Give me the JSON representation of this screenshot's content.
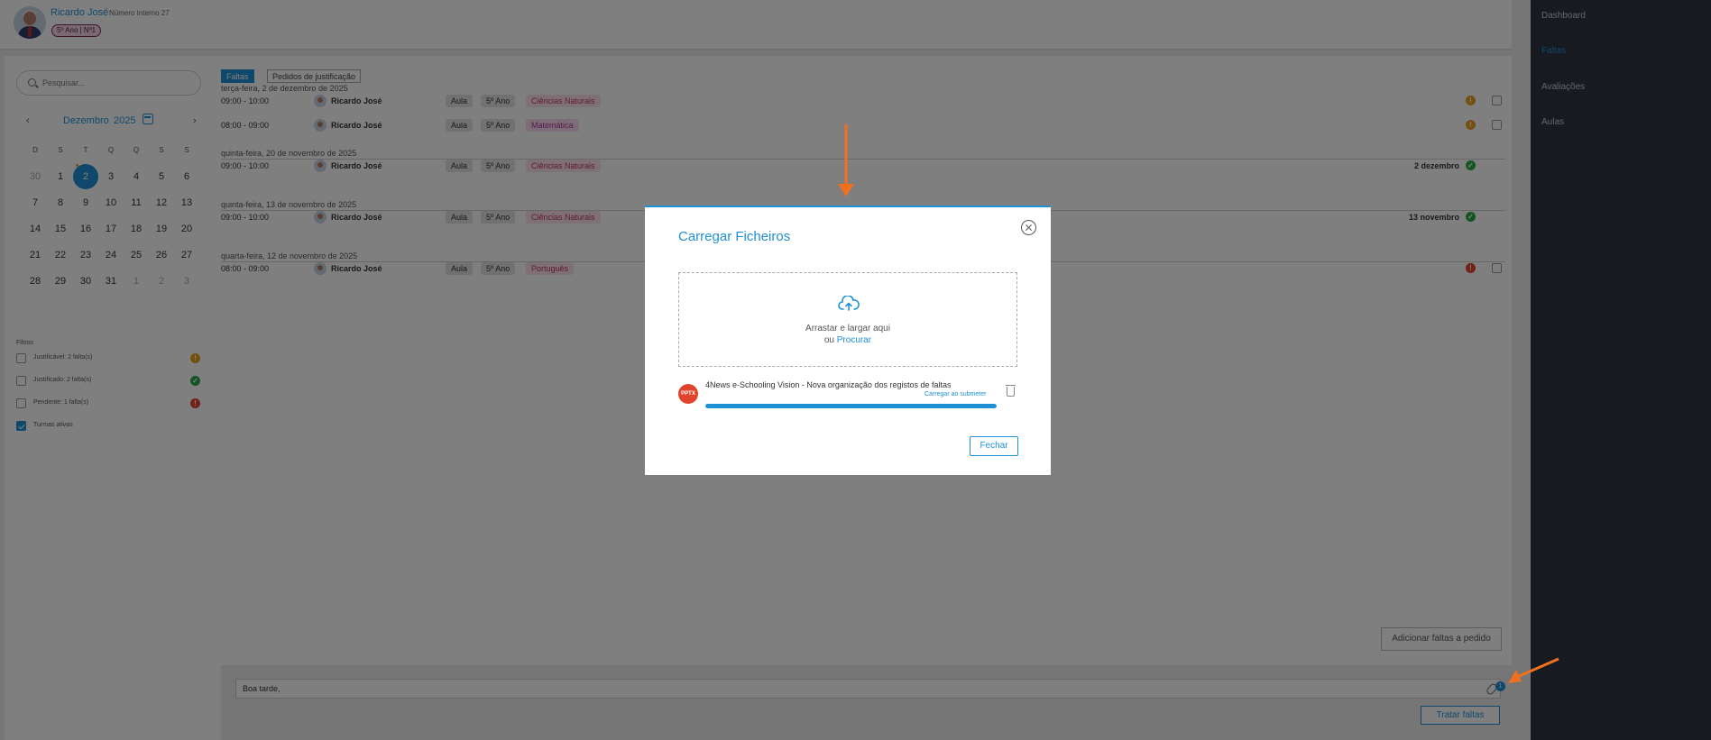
{
  "header": {
    "student_name": "Ricardo José",
    "internal_number": "Número Interno 27",
    "class_badge": "5º Ano | Nº1"
  },
  "sidebar": {
    "items": [
      {
        "label": "Dashboard",
        "active": false
      },
      {
        "label": "Faltas",
        "active": true
      },
      {
        "label": "Avaliações",
        "active": false
      },
      {
        "label": "Aulas",
        "active": false
      }
    ]
  },
  "search": {
    "placeholder": "Pesquisar..."
  },
  "calendar": {
    "month": "Dezembro",
    "year": "2025",
    "prev": "‹",
    "next": "›",
    "weekdays": [
      "D",
      "S",
      "T",
      "Q",
      "Q",
      "S",
      "S"
    ],
    "weeks": [
      [
        "30",
        "1",
        "2",
        "3",
        "4",
        "5",
        "6"
      ],
      [
        "7",
        "8",
        "9",
        "10",
        "11",
        "12",
        "13"
      ],
      [
        "14",
        "15",
        "16",
        "17",
        "18",
        "19",
        "20"
      ],
      [
        "21",
        "22",
        "23",
        "24",
        "25",
        "26",
        "27"
      ],
      [
        "28",
        "29",
        "30",
        "31",
        "1",
        "2",
        "3"
      ]
    ],
    "selected_day": "2"
  },
  "filters": {
    "title": "Filtros",
    "items": [
      {
        "label": "Justificável: 2 falta(s)",
        "checked": false,
        "status": "!"
      },
      {
        "label": "Justificado: 2 falta(s)",
        "checked": false,
        "status": "✓"
      },
      {
        "label": "Pendente: 1 falta(s)",
        "checked": false,
        "status": "!"
      },
      {
        "label": "Turmas ativas",
        "checked": true,
        "status": ""
      }
    ]
  },
  "tabs": [
    {
      "label": "Faltas",
      "active": true
    },
    {
      "label": "Pedidos de justificação",
      "active": false
    }
  ],
  "groups": [
    {
      "date": "terça-feira, 2 de dezembro de 2025",
      "rows": [
        {
          "time": "09:00 - 10:00",
          "student": "Ricardo José",
          "type": "Aula",
          "year": "5º Ano",
          "subject": "Ciências Naturais",
          "status": "!",
          "justified_date": "",
          "checkbox": true
        },
        {
          "time": "08:00 - 09:00",
          "student": "Ricardo José",
          "type": "Aula",
          "year": "5º Ano",
          "subject": "Matemática",
          "status": "!",
          "justified_date": "",
          "checkbox": true
        }
      ]
    },
    {
      "date": "quinta-feira, 20 de novembro de 2025",
      "rows": [
        {
          "time": "09:00 - 10:00",
          "student": "Ricardo José",
          "type": "Aula",
          "year": "5º Ano",
          "subject": "Ciências Naturais",
          "status": "✓",
          "justified_date": "2 dezembro",
          "checkbox": false
        }
      ]
    },
    {
      "date": "quinta-feira, 13 de novembro de 2025",
      "rows": [
        {
          "time": "09:00 - 10:00",
          "student": "Ricardo José",
          "type": "Aula",
          "year": "5º Ano",
          "subject": "Ciências Naturais",
          "status": "✓",
          "justified_date": "13 novembro",
          "checkbox": false
        }
      ]
    },
    {
      "date": "quarta-feira, 12 de novembro de 2025",
      "rows": [
        {
          "time": "08:00 - 09:00",
          "student": "Ricardo José",
          "type": "Aula",
          "year": "5º Ano",
          "subject": "Português",
          "status": "!",
          "justified_date": "",
          "checkbox": true
        }
      ]
    }
  ],
  "actions": {
    "add_label": "Adicionar faltas a pedido",
    "treat_label": "Tratar faltas"
  },
  "composer": {
    "message": "Boa tarde,",
    "attachment_count": "1"
  },
  "modal": {
    "title": "Carregar Ficheiros",
    "drop_text": "Arrastar e largar aqui",
    "drop_or": "ou",
    "browse_link": "Procurar",
    "file_type": "PPTX",
    "file_name": "4News e-Schooling Vision - Nova organização dos registos de faltas",
    "file_status": "Carregar ao submeter",
    "progress": 1.0,
    "close_label": "Fechar"
  },
  "colors": {
    "accent": "#1e90d6",
    "sidebar_bg": "#2f3540",
    "warning": "#e8a020",
    "success": "#2aa84a",
    "danger": "#e0442c",
    "annotation_arrow": "#f07020"
  }
}
